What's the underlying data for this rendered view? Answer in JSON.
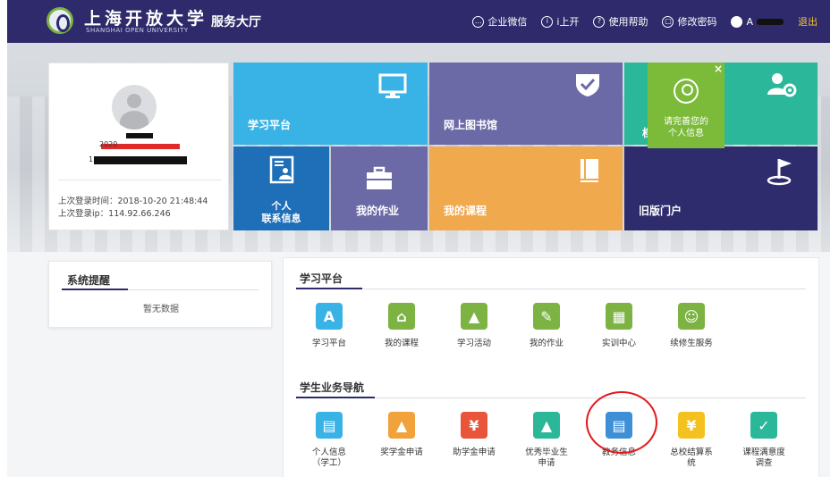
{
  "header": {
    "logo_cn": "上海开放大学",
    "logo_en": "SHANGHAI OPEN UNIVERSITY",
    "hall_title": "服务大厅",
    "links": [
      {
        "label": "企业微信",
        "icon": "chat-icon"
      },
      {
        "label": "i上开",
        "icon": "i-icon"
      },
      {
        "label": "使用帮助",
        "icon": "help-icon"
      },
      {
        "label": "修改密码",
        "icon": "lock-icon"
      }
    ],
    "user_name": "A",
    "exit_label": "退出"
  },
  "profile": {
    "partial_id": "2020",
    "partial_no": "1",
    "last_login_time": "上次登录时间：2018-10-20 21:48:44",
    "last_login_ip": "上次登录ip：114.92.66.246"
  },
  "tiles": {
    "study_platform": "学习平台",
    "online_library": "网上图书馆",
    "teal_partial": "档",
    "contact_line1": "个人",
    "contact_line2": "联系信息",
    "my_homework": "我的作业",
    "my_course": "我的课程",
    "old_portal": "旧版门户"
  },
  "popup": {
    "close": "×",
    "line1": "请完善您的",
    "line2": "个人信息"
  },
  "alerts": {
    "title": "系统提醒",
    "empty": "暂无数据"
  },
  "study": {
    "title": "学习平台",
    "apps": [
      {
        "label": "学习平台",
        "icon": "book-a-icon",
        "color": "#39b2e6"
      },
      {
        "label": "我的课程",
        "icon": "teacher-icon",
        "color": "#7cb342"
      },
      {
        "label": "学习活动",
        "icon": "podium-icon",
        "color": "#7cb342"
      },
      {
        "label": "我的作业",
        "icon": "edit-doc-icon",
        "color": "#7cb342"
      },
      {
        "label": "实训中心",
        "icon": "training-icon",
        "color": "#7cb342"
      },
      {
        "label": "续修生服务",
        "icon": "people-icon",
        "color": "#7cb342"
      }
    ]
  },
  "student": {
    "title": "学生业务导航",
    "apps": [
      {
        "label": "个人信息（学工）",
        "line1": "个人信息",
        "line2": "（学工）",
        "icon": "id-card-icon",
        "color": "#39b2e6"
      },
      {
        "label": "奖学金申请",
        "icon": "graduation-cap-icon",
        "color": "#f1a23a"
      },
      {
        "label": "助学金申请",
        "icon": "coin-hand-icon",
        "color": "#e8553b"
      },
      {
        "label": "优秀毕业生申请",
        "line1": "优秀毕业生",
        "line2": "申请",
        "icon": "grad-cap-icon",
        "color": "#2ab79a"
      },
      {
        "label": "教务信息",
        "icon": "document-icon",
        "color": "#3d8fd6"
      },
      {
        "label": "总校结算系统",
        "line1": "总校结算系",
        "line2": "统",
        "icon": "yen-icon",
        "color": "#f4c21f"
      },
      {
        "label": "课程满意度调查",
        "line1": "课程满意度",
        "line2": "调查",
        "icon": "survey-icon",
        "color": "#2ab79a"
      }
    ]
  }
}
